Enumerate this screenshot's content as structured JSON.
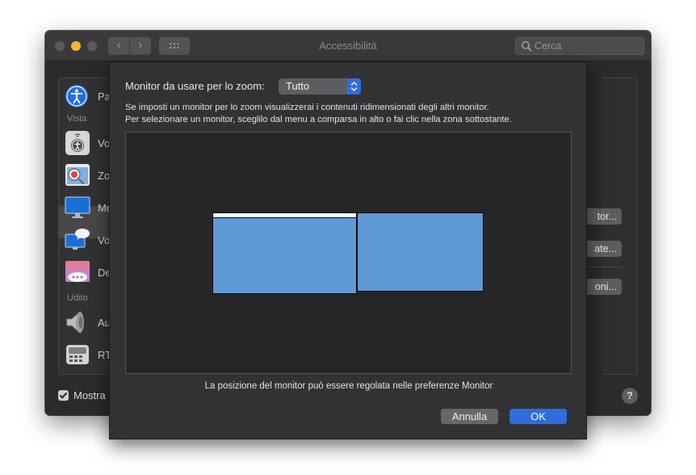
{
  "window": {
    "title": "Accessibilità",
    "search_placeholder": "Cerca",
    "nav_back": "‹",
    "nav_forward": "›"
  },
  "sidebar": {
    "items": [
      {
        "label": "Pa",
        "icon": "accessibility-icon"
      },
      {
        "label": "Vo",
        "icon": "voiceover-icon"
      },
      {
        "label": "Zo",
        "icon": "zoom-icon"
      },
      {
        "label": "Mo",
        "icon": "display-icon"
      },
      {
        "label": "Vo",
        "icon": "spoken-content-icon"
      },
      {
        "label": "De",
        "icon": "descriptions-icon"
      },
      {
        "label": "Au",
        "icon": "audio-icon"
      },
      {
        "label": "RT",
        "icon": "rtt-icon"
      }
    ],
    "sections": [
      "Vista",
      "Udito"
    ],
    "selected_index": 2
  },
  "right_buttons": [
    "tor...",
    "ate...",
    "oni..."
  ],
  "footer": {
    "show_checkbox_label": "Mostra",
    "show_checked": true,
    "help": "?"
  },
  "sheet": {
    "monitor_label": "Monitor da usare per lo zoom:",
    "monitor_select_value": "Tutto",
    "desc_line1": "Se imposti un monitor per lo zoom visualizzerai i contenuti ridimensionati degli altri monitor.",
    "desc_line2": "Per selezionare un monitor, sceglilo dal menu a comparsa in alto o fai clic nella zona sottostante.",
    "footnote": "La posizione del monitor può essere regolata nelle preferenze Monitor",
    "cancel_label": "Annulla",
    "ok_label": "OK"
  },
  "colors": {
    "accent": "#2f6ddf",
    "monitor_fill": "#5f9ad6",
    "minimize": "#f5b731"
  }
}
